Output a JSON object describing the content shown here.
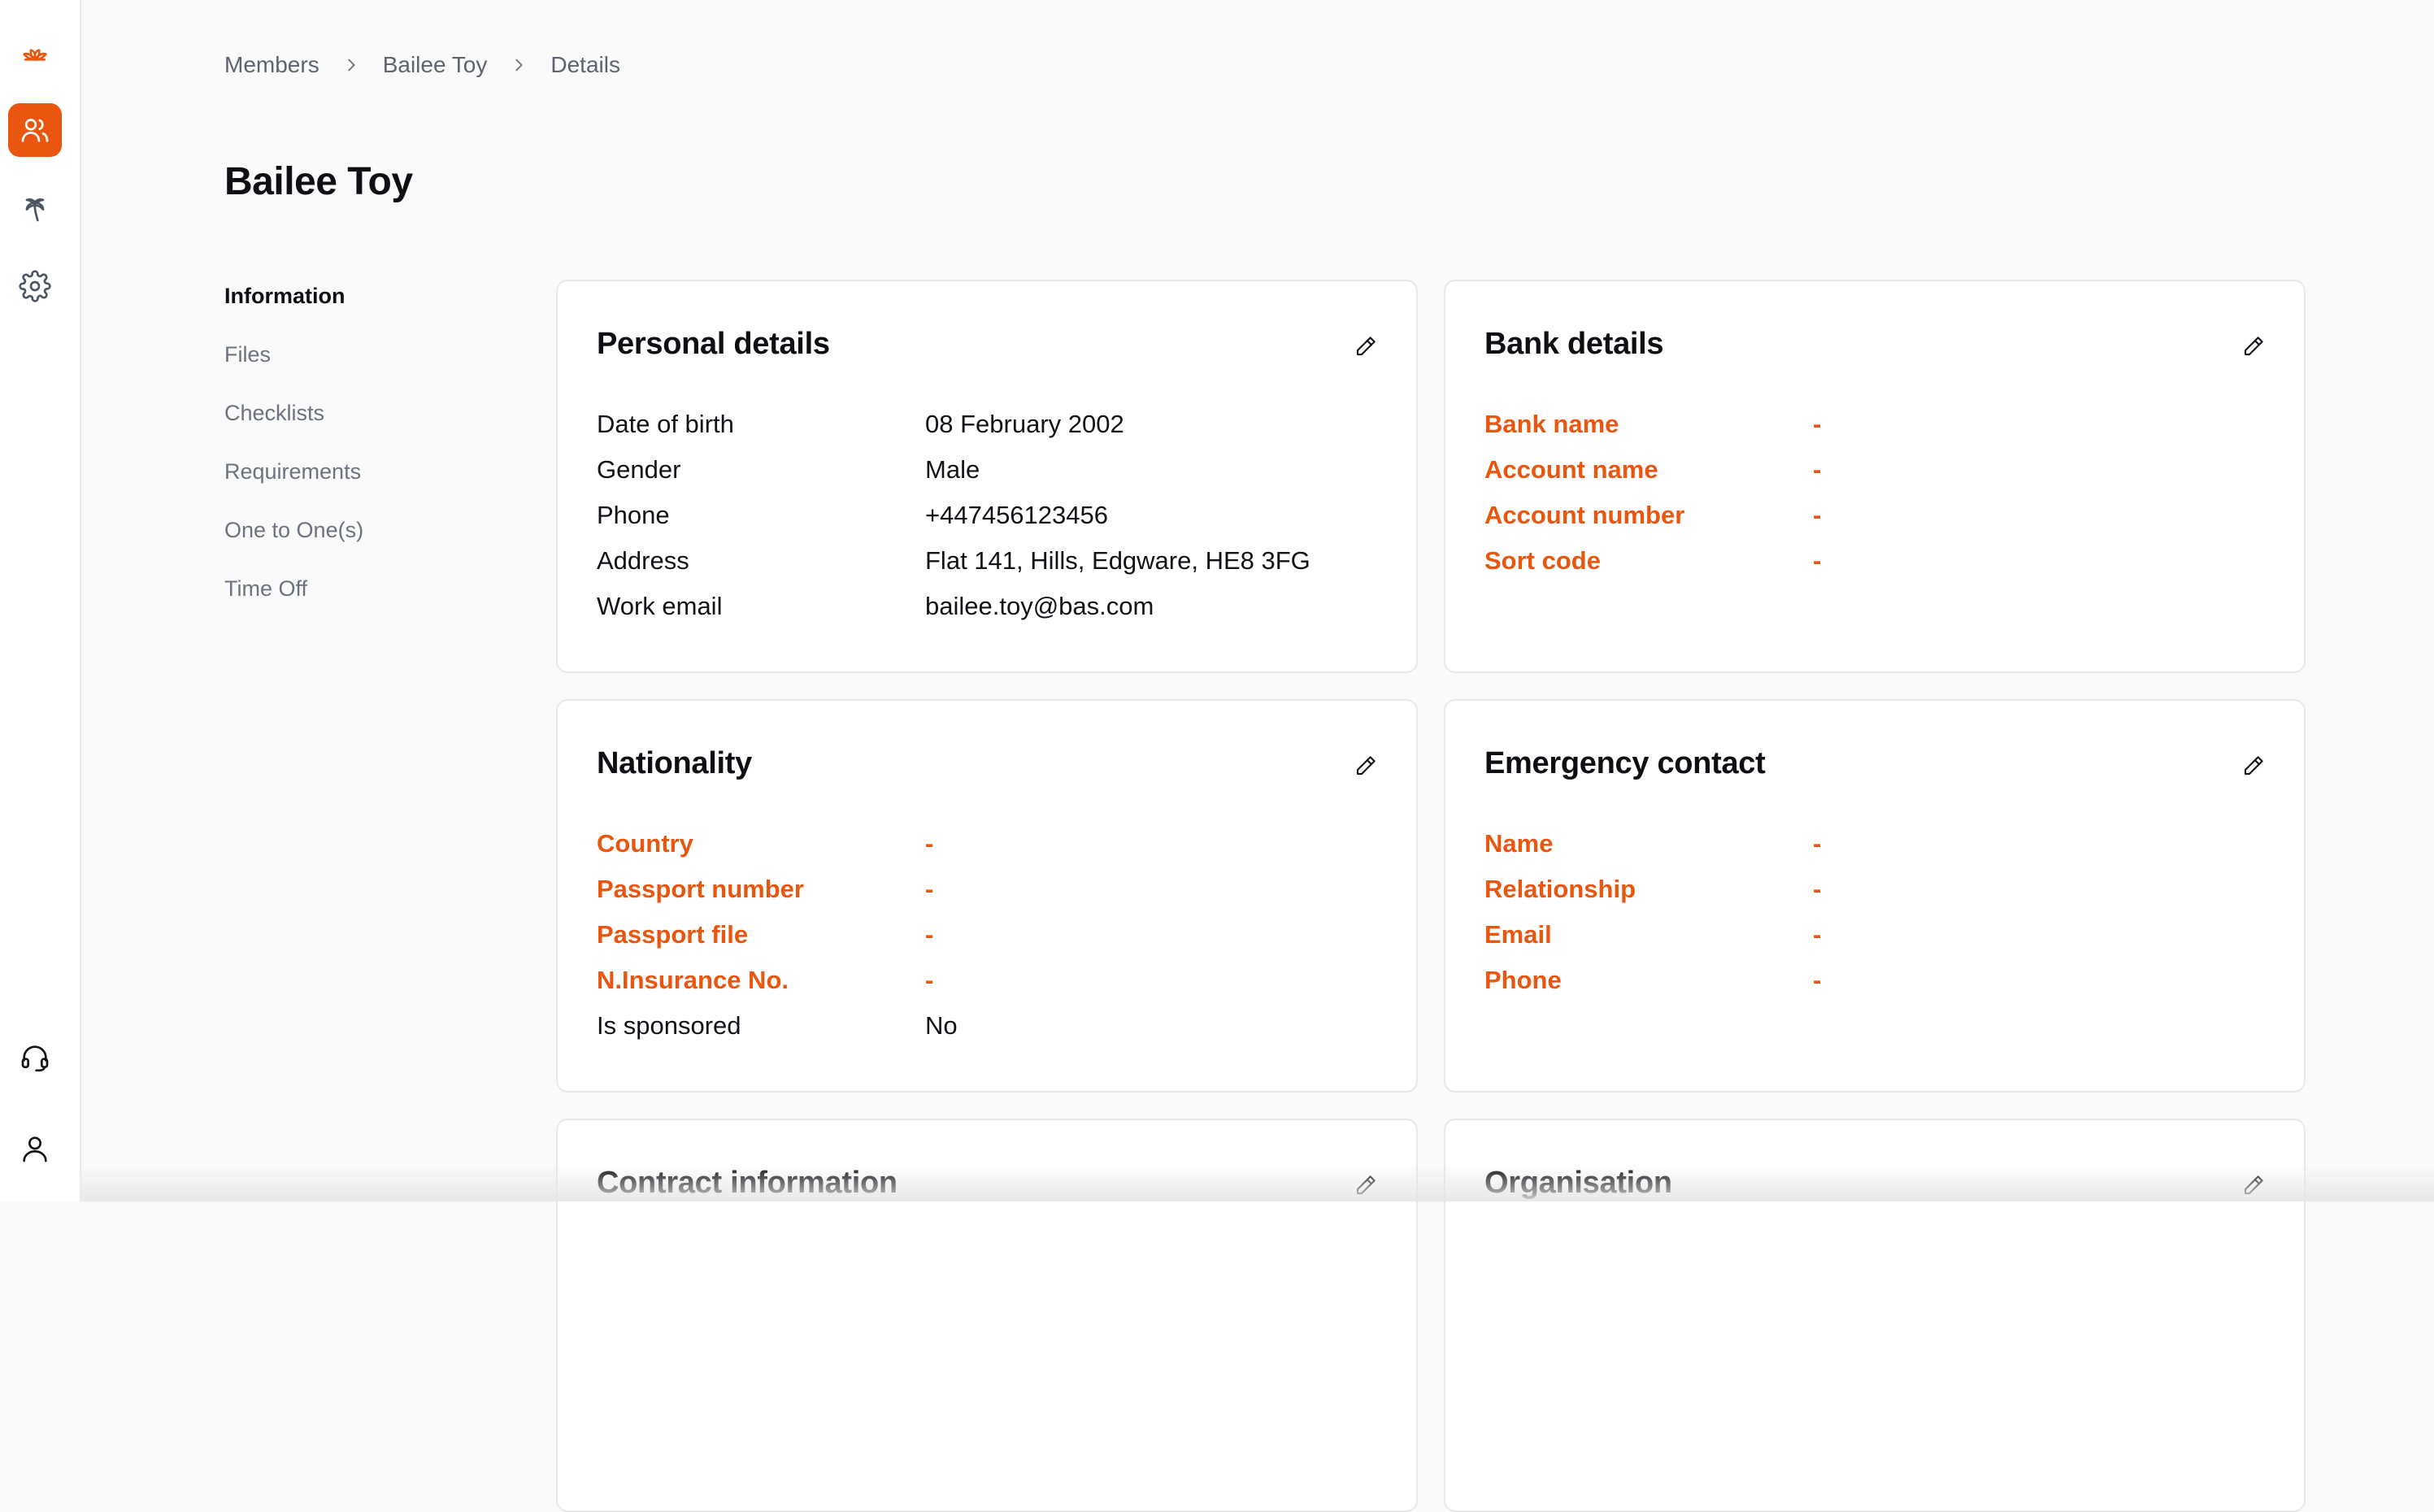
{
  "colors": {
    "accent": "#e8560f",
    "text": "#111318",
    "muted": "#6b7280",
    "background": "#fafafa"
  },
  "rail": {
    "logo": "lotus-logo-icon",
    "items": [
      {
        "icon": "users-icon",
        "active": true
      },
      {
        "icon": "palm-tree-icon",
        "active": false
      },
      {
        "icon": "gear-icon",
        "active": false
      }
    ],
    "bottom": [
      {
        "icon": "headset-icon"
      },
      {
        "icon": "user-icon"
      }
    ]
  },
  "breadcrumb": {
    "items": [
      "Members",
      "Bailee Toy",
      "Details"
    ]
  },
  "page": {
    "title": "Bailee Toy"
  },
  "subnav": {
    "items": [
      "Information",
      "Files",
      "Checklists",
      "Requirements",
      "One to One(s)",
      "Time Off"
    ],
    "active": "Information"
  },
  "cards": {
    "personal": {
      "title": "Personal details",
      "rows": [
        {
          "label": "Date of birth",
          "value": "08 February 2002"
        },
        {
          "label": "Gender",
          "value": "Male"
        },
        {
          "label": "Phone",
          "value": "+447456123456"
        },
        {
          "label": "Address",
          "value": "Flat 141, Hills, Edgware, HE8 3FG"
        },
        {
          "label": "Work email",
          "value": "bailee.toy@bas.com"
        }
      ]
    },
    "bank": {
      "title": "Bank details",
      "rows": [
        {
          "label": "Bank name",
          "value": "-"
        },
        {
          "label": "Account name",
          "value": "-"
        },
        {
          "label": "Account number",
          "value": "-"
        },
        {
          "label": "Sort code",
          "value": "-"
        }
      ]
    },
    "nationality": {
      "title": "Nationality",
      "rows": [
        {
          "label": "Country",
          "value": "-"
        },
        {
          "label": "Passport number",
          "value": "-"
        },
        {
          "label": "Passport file",
          "value": "-"
        },
        {
          "label": "N.Insurance No.",
          "value": "-"
        },
        {
          "label": "Is sponsored",
          "value": "No"
        }
      ]
    },
    "emergency": {
      "title": "Emergency contact",
      "rows": [
        {
          "label": "Name",
          "value": "-"
        },
        {
          "label": "Relationship",
          "value": "-"
        },
        {
          "label": "Email",
          "value": "-"
        },
        {
          "label": "Phone",
          "value": "-"
        }
      ]
    },
    "contract": {
      "title": "Contract information"
    },
    "organisation": {
      "title": "Organisation"
    }
  }
}
